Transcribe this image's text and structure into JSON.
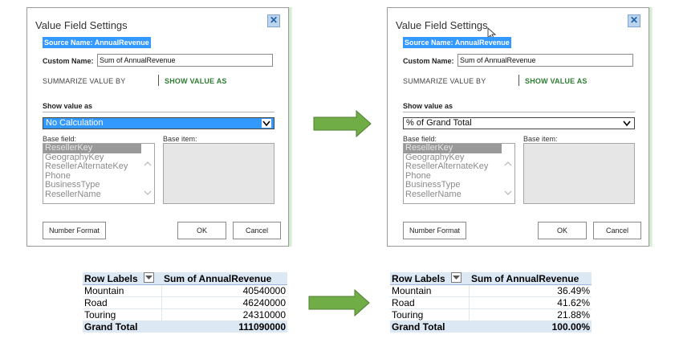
{
  "colors": {
    "accent_green": "#2e7d32",
    "selection_blue": "#3399ff",
    "arrow_fill": "#70ad47",
    "pivot_header": "#dde8f5"
  },
  "dialog_before": {
    "title": "Value Field Settings",
    "close_icon": "close-icon",
    "source_name": "Source Name: AnnualRevenue",
    "custom_name_label": "Custom Name:",
    "custom_name_value": "Sum of AnnualRevenue",
    "tab_summarize": "SUMMARIZE VALUE BY",
    "tab_show": "SHOW VALUE AS",
    "show_value_as_label": "Show value as",
    "calculation": "No Calculation",
    "base_field_label": "Base field:",
    "base_item_label": "Base item:",
    "base_fields": [
      "ResellerKey",
      "GeographyKey",
      "ResellerAlternateKey",
      "Phone",
      "BusinessType",
      "ResellerName"
    ],
    "buttons": {
      "number_format": "Number Format",
      "ok": "OK",
      "cancel": "Cancel"
    }
  },
  "dialog_after": {
    "title": "Value Field Settings",
    "close_icon": "close-icon",
    "source_name": "Source Name: AnnualRevenue",
    "custom_name_label": "Custom Name:",
    "custom_name_value": "Sum of AnnualRevenue",
    "tab_summarize": "SUMMARIZE VALUE BY",
    "tab_show": "SHOW VALUE AS",
    "show_value_as_label": "Show value as",
    "calculation": "% of Grand Total",
    "base_field_label": "Base field:",
    "base_item_label": "Base item:",
    "base_fields": [
      "ResellerKey",
      "GeographyKey",
      "ResellerAlternateKey",
      "Phone",
      "BusinessType",
      "ResellerName"
    ],
    "buttons": {
      "number_format": "Number Format",
      "ok": "OK",
      "cancel": "Cancel"
    }
  },
  "pivot_before": {
    "col_labels": "Row Labels",
    "col_values": "Sum of AnnualRevenue",
    "rows": [
      {
        "label": "Mountain",
        "value": "40540000"
      },
      {
        "label": "Road",
        "value": "46240000"
      },
      {
        "label": "Touring",
        "value": "24310000"
      }
    ],
    "total_label": "Grand Total",
    "total_value": "111090000"
  },
  "pivot_after": {
    "col_labels": "Row Labels",
    "col_values": "Sum of AnnualRevenue",
    "rows": [
      {
        "label": "Mountain",
        "value": "36.49%"
      },
      {
        "label": "Road",
        "value": "41.62%"
      },
      {
        "label": "Touring",
        "value": "21.88%"
      }
    ],
    "total_label": "Grand Total",
    "total_value": "100.00%"
  }
}
